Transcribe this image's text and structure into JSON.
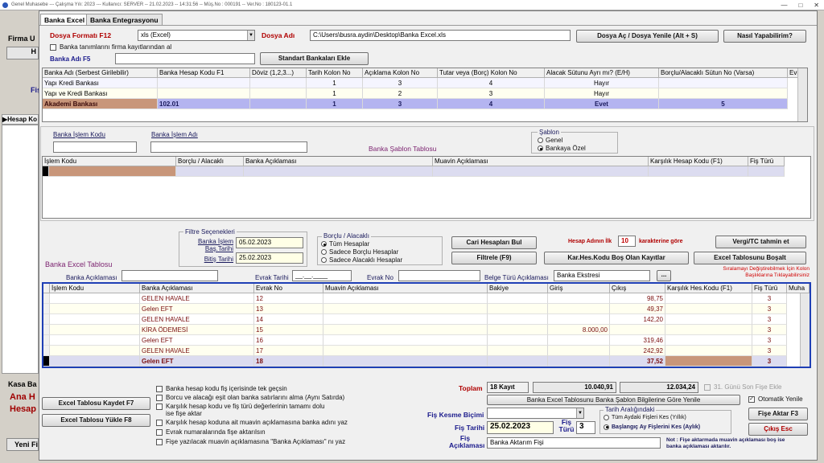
{
  "window": {
    "title": "Genel Muhasebe  ---  Çalışma Yılı: 2023  ---  Kullanıcı: SERVER -- 21.02.2023 -- 14:31:56 -- Müş.No : 000191 -- Ver.No : 180123-01.1"
  },
  "background": {
    "firma": "Firma U",
    "hesap": "Hesap Ko",
    "fis": "Fiş",
    "kasa": "Kasa Ba",
    "ana": "Ana H",
    "hesap2": "Hesap",
    "yeni": "Yeni Fi",
    "h_btn": "H"
  },
  "tabs": [
    "Banka Excel",
    "Banka Entegrasyonu"
  ],
  "top": {
    "dosya_formati_label": "Dosya Formatı F12",
    "dosya_formati_value": "xls (Excel)",
    "dosya_adi_label": "Dosya Adı",
    "dosya_adi_value": "C:\\Users\\busra.aydin\\Desktop\\Banka Excel.xls",
    "dosya_ac_btn": "Dosya Aç / Dosya Yenile (Alt + S)",
    "nasil_btn": "Nasıl Yapabilirim?",
    "banka_tanim_chk": "Banka tanımlarını firma kayıtlarından al",
    "banka_adi_label": "Banka Adı F5",
    "standart_btn": "Standart Bankaları Ekle"
  },
  "bank_grid": {
    "headers": [
      "Banka Adı (Serbest Girilebilir)",
      "Banka Hesap Kodu F1",
      "Döviz (1,2,3...)",
      "Tarih Kolon No",
      "Açıklama Kolon No",
      "Tutar veya (Borç) Kolon No",
      "Alacak Sütunu Ayrı mı? (E/H)",
      "Borçlu/Alacaklı Sütun No (Varsa)",
      "Evr"
    ],
    "rows": [
      {
        "ad": "Yapı Kredi Bankası",
        "kod": "",
        "doviz": "",
        "tarih": "1",
        "aciklama": "3",
        "tutar": "4",
        "ayri": "Hayır",
        "ba": ""
      },
      {
        "ad": "Yapı ve Kredi Bankası",
        "kod": "",
        "doviz": "",
        "tarih": "1",
        "aciklama": "2",
        "tutar": "3",
        "ayri": "Hayır",
        "ba": ""
      },
      {
        "ad": "Akademi Bankası",
        "kod": "102.01",
        "doviz": "",
        "tarih": "1",
        "aciklama": "3",
        "tutar": "4",
        "ayri": "Evet",
        "ba": "5"
      }
    ]
  },
  "sablon": {
    "islem_kodu_label": "Banka İşlem Kodu",
    "islem_adi_label": "Banka İşlem Adı",
    "tablo_label": "Banka Şablon Tablosu",
    "sablon_title": "Şablon",
    "opt_genel": "Genel",
    "opt_ozel": "Bankaya Özel",
    "headers": [
      "İşlem Kodu",
      "Borçlu / Alacaklı",
      "Banka Açıklaması",
      "Muavin Açıklaması",
      "Karşılık Hesap Kodu (F1)",
      "Fiş Türü"
    ]
  },
  "filter": {
    "title": "Filtre Seçenekleri",
    "bas_label": "Banka İşlem Baş.Tarihi",
    "bas_value": "05.02.2023",
    "bit_label": "Bitiş Tarihi",
    "bit_value": "25.02.2023",
    "ba_title": "Borçlu / Alacaklı",
    "ba_opts": [
      "Tüm Hesaplar",
      "Sadece Borçlu Hesaplar",
      "Sadece Alacaklı Hesaplar"
    ],
    "cari_btn": "Cari Hesapları Bul",
    "filtrele_btn": "Filtrele (F9)",
    "hesap_adi_label": "Hesap Adının İlk",
    "hesap_adi_value": "10",
    "karakter_label": "karakterine göre",
    "karhes_btn": "Kar.Hes.Kodu Boş Olan Kayıtlar",
    "vergi_btn": "Vergi/TC tahmin et",
    "bosalt_btn": "Excel Tablosunu Boşalt"
  },
  "excel": {
    "title": "Banka Excel Tablosu",
    "banka_aciklamasi_label": "Banka Açıklaması",
    "evrak_tarihi_label": "Evrak Tarihi",
    "evrak_tarihi_value": "__.__.____",
    "evrak_no_label": "Evrak No",
    "belge_label": "Belge Türü Açıklaması",
    "belge_value": "Banka Ekstresi",
    "sort_note": "Sıralamayı Değiştirebilmek İçin Kolon Başlıklarına Tıklayabilirsiniz",
    "headers": [
      "İşlem Kodu",
      "Banka Açıklaması",
      "Evrak No",
      "Muavin Açıklaması",
      "Bakiye",
      "Giriş",
      "Çıkış",
      "Karşılık Hes.Kodu (F1)",
      "Fiş Türü",
      "Muha"
    ],
    "rows": [
      {
        "kod": "",
        "aciklama": "GELEN HAVALE",
        "evrak": "12",
        "muavin": "",
        "bakiye": "",
        "giris": "",
        "cikis": "98,75",
        "karsilik": "",
        "fis": "3"
      },
      {
        "kod": "",
        "aciklama": "Gelen EFT",
        "evrak": "13",
        "muavin": "",
        "bakiye": "",
        "giris": "",
        "cikis": "49,37",
        "karsilik": "",
        "fis": "3"
      },
      {
        "kod": "",
        "aciklama": "GELEN HAVALE",
        "evrak": "14",
        "muavin": "",
        "bakiye": "",
        "giris": "",
        "cikis": "142,20",
        "karsilik": "",
        "fis": "3"
      },
      {
        "kod": "",
        "aciklama": "KİRA ÖDEMESİ",
        "evrak": "15",
        "muavin": "",
        "bakiye": "",
        "giris": "8.000,00",
        "cikis": "",
        "karsilik": "",
        "fis": "3"
      },
      {
        "kod": "",
        "aciklama": "Gelen EFT",
        "evrak": "16",
        "muavin": "",
        "bakiye": "",
        "giris": "",
        "cikis": "319,46",
        "karsilik": "",
        "fis": "3"
      },
      {
        "kod": "",
        "aciklama": "GELEN HAVALE",
        "evrak": "17",
        "muavin": "",
        "bakiye": "",
        "giris": "",
        "cikis": "242,92",
        "karsilik": "",
        "fis": "3"
      },
      {
        "kod": "",
        "aciklama": "Gelen EFT",
        "evrak": "18",
        "muavin": "",
        "bakiye": "",
        "giris": "",
        "cikis": "37,52",
        "karsilik": "",
        "fis": "3"
      }
    ]
  },
  "bottom": {
    "kaydet_btn": "Excel Tablosu Kaydet F7",
    "yukle_btn": "Excel Tablosu Yükle F8",
    "checks": [
      "Banka hesap kodu fiş içerisinde tek geçsin",
      "Borcu ve alacağı eşit olan banka satırlarını alma (Aynı Satırda)",
      "Karşılık hesap kodu ve fiş türü değerlerinin tamamı dolu ise fişe aktar",
      "Karşılık hesap koduna ait muavin açıklamasına banka adını yaz",
      "Evrak numaralarında fişe aktarılsın",
      "Fişe yazılacak muavin açıklamasına \"Banka Açıklaması\" nı yaz"
    ],
    "toplam_label": "Toplam",
    "kayit": "18 Kayıt",
    "toplam_giris": "10.040,91",
    "toplam_cikis": "12.034,24",
    "son_fis_label": "31. Günü Son Fişe Ekle",
    "sablon_yenile_btn": "Banka Excel Tablosunu Banka Şablon Bilgilerine Göre Yenile",
    "otomatik_label": "Otomatik Yenile",
    "kesme_label": "Fiş Kesme Biçimi",
    "fis_tarihi_label": "Fiş Tarihi",
    "fis_tarihi_value": "25.02.2023",
    "fis_turu_label": "Fiş Türü",
    "fis_turu_value": "3",
    "aralik_title": "Tarih Aralığındaki",
    "aralik_opts": [
      "Tüm Aydaki Fişleri Kes (Yıllık)",
      "Başlangıç Ay Fişlerini Kes (Aylık)"
    ],
    "fise_aktar_btn": "Fişe Aktar F3",
    "cikis_btn": "Çıkış Esc",
    "fis_aciklamasi_label": "Fiş Açıklaması",
    "fis_aciklamasi_value": "Banka Aktarım Fişi",
    "note": "Not : Fişe aktarmada muavin açıklaması boş ise banka açıklaması aktarılır."
  }
}
